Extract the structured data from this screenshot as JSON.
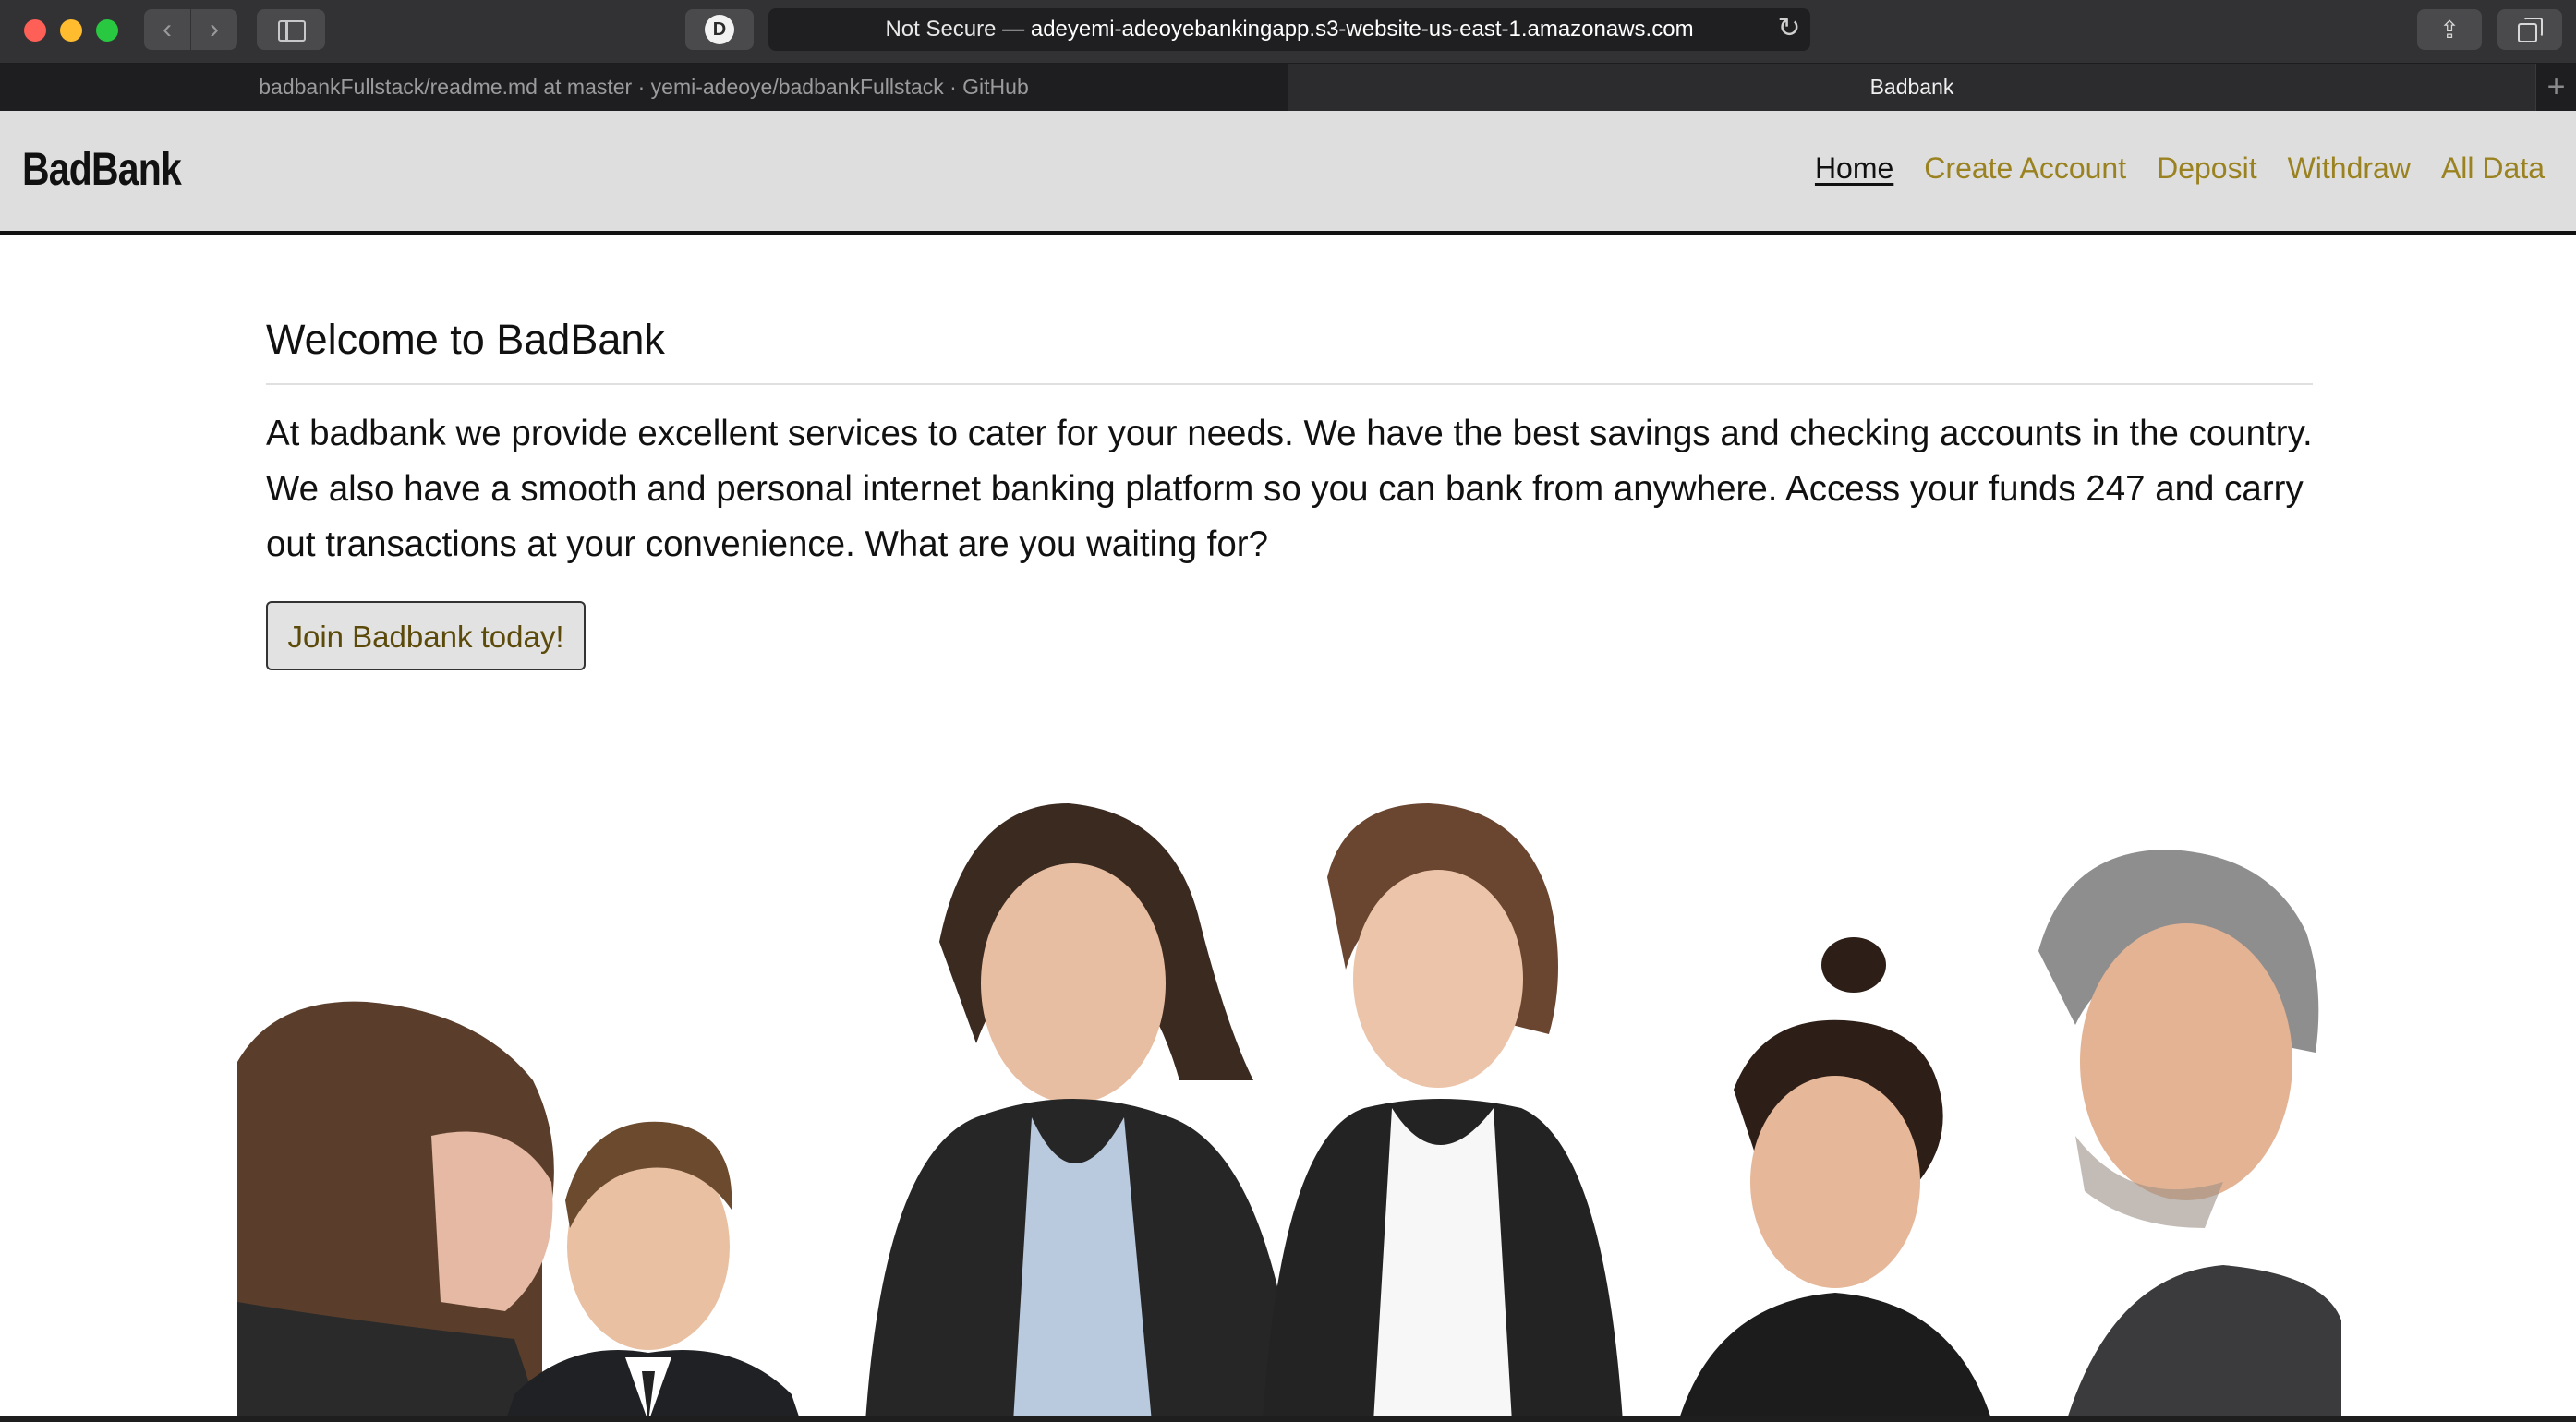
{
  "browser": {
    "url_prefix": "Not Secure —",
    "url_host": "adeyemi-adeoyebankingapp.s3-website-us-east-1.amazonaws.com",
    "privacy_badge": "D",
    "tabs": [
      {
        "label": "badbankFullstack/readme.md at master · yemi-adeoye/badbankFullstack · GitHub",
        "active": false
      },
      {
        "label": "Badbank",
        "active": true
      }
    ],
    "new_tab_label": "+"
  },
  "navbar": {
    "brand": "BadBank",
    "links": [
      {
        "label": "Home",
        "current": true
      },
      {
        "label": "Create Account",
        "current": false
      },
      {
        "label": "Deposit",
        "current": false
      },
      {
        "label": "Withdraw",
        "current": false
      },
      {
        "label": "All Data",
        "current": false
      }
    ]
  },
  "main": {
    "heading": "Welcome to BadBank",
    "paragraph": "At badbank we provide excellent services to cater for your needs. We have the best savings and checking accounts in the country. We also have a smooth and personal internet banking platform so you can bank from anywhere. Access your funds 247 and carry out transactions at your convenience. What are you waiting for?",
    "cta_label": "Join Badbank today!"
  },
  "colors": {
    "nav_link": "#9a8220",
    "navbar_bg": "#dedede",
    "cta_text": "#5c4a0a"
  }
}
